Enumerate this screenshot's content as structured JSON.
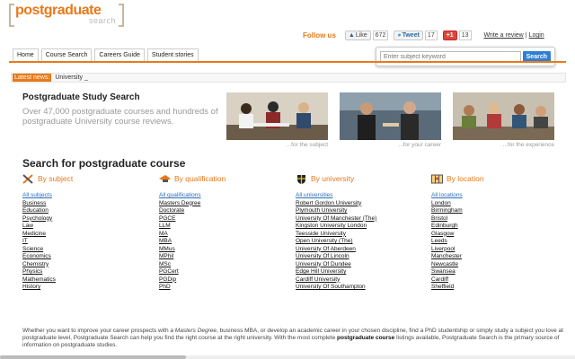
{
  "logo": {
    "line1": "postgraduate",
    "line2": "search"
  },
  "social": {
    "follow_label": "Follow us",
    "like_label": "Like",
    "like_count": "672",
    "tweet_label": "Tweet",
    "tweet_count": "17",
    "gplus_label": "+1",
    "gplus_count": "13",
    "write_review": "Write a review",
    "separator": "|",
    "login": "Login"
  },
  "search": {
    "placeholder": "Enter subject keyword",
    "button": "Search"
  },
  "tabs": [
    "Home",
    "Course Search",
    "Careers Guide",
    "Student stories"
  ],
  "news": {
    "label": "Latest news:",
    "text": "University _"
  },
  "hero": {
    "title": "Postgraduate Study Search",
    "description": "Over 47,000 postgraduate courses and hundreds of postgraduate University course reviews.",
    "captions": [
      "...for the subject",
      "...for your career",
      "...for the experience"
    ]
  },
  "section_title": "Search for postgraduate course",
  "columns": [
    {
      "heading": "By subject",
      "icon": "tools-icon",
      "all": "All subjects",
      "items": [
        "Business",
        "Education",
        "Psychology",
        "Law",
        "Medicine",
        "IT",
        "Science",
        "Economics",
        "Chemistry",
        "Physics",
        "Mathematics",
        "History"
      ]
    },
    {
      "heading": "By qualification",
      "icon": "graduation-cap-icon",
      "all": "All qualifications",
      "items": [
        "Masters Degree",
        "Doctorate",
        "PGCE",
        "LLM",
        "MA",
        "MBA",
        "MMus",
        "MPhil",
        "MSc",
        "PGCert",
        "PGDip",
        "PhD"
      ]
    },
    {
      "heading": "By university",
      "icon": "shield-icon",
      "all": "All universities",
      "items": [
        "Robert Gordon University",
        "Plymouth University",
        "University Of Manchester (The)",
        "Kingston University London",
        "Teesside University",
        "Open University (The)",
        "University Of Aberdeen",
        "University Of Lincoln",
        "University Of Dundee",
        "Edge Hill University",
        "Cardiff University",
        "University Of Southampton"
      ]
    },
    {
      "heading": "By location",
      "icon": "map-icon",
      "all": "All locations",
      "items": [
        "London",
        "Birmingham",
        "Bristol",
        "Edinburgh",
        "Glasgow",
        "Leeds",
        "Liverpool",
        "Manchester",
        "Newcastle",
        "Swansea",
        "Cardiff",
        "Sheffield"
      ]
    }
  ],
  "footer": {
    "part1": "Whether you want to improve your career prospects with a ",
    "em1": "Masters Degree",
    "part2": ", business MBA, or develop an academic career in your chosen discipline, find a PhD studentship or simply study a subject you love at postgraduate level, Postgraduate Search can help you find the right course at the right university. With the most complete ",
    "bold1": "postgraduate course",
    "part3": " listings available, Postgraduate Search is the primary source of information on postgraduate studies."
  },
  "colors": {
    "accent": "#e8791a",
    "link": "#2a6db8",
    "search_button": "#2f7fd6"
  }
}
